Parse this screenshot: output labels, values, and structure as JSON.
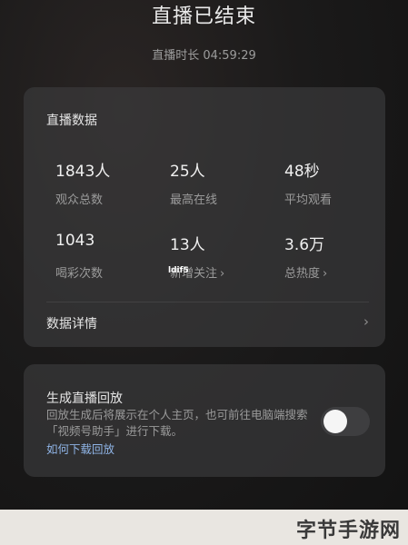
{
  "header": {
    "title": "直播已结束",
    "duration": "直播时长 04:59:29"
  },
  "stats_card": {
    "title": "直播数据",
    "stats": [
      {
        "value": "1843人",
        "label": "观众总数"
      },
      {
        "value": "25人",
        "label": "最高在线"
      },
      {
        "value": "48秒",
        "label": "平均观看"
      },
      {
        "value": "1043",
        "label": "喝彩次数"
      },
      {
        "value": "13人",
        "label": "新增关注",
        "chevron": "›"
      },
      {
        "value": "3.6万",
        "label": "总热度",
        "chevron": "›"
      }
    ],
    "overlay_text": "ldif5",
    "detail_label": "数据详情",
    "detail_chevron": "›"
  },
  "replay_card": {
    "title": "生成直播回放",
    "description": "回放生成后将展示在个人主页，也可前往电脑端搜索「视频号助手」进行下载。",
    "link": "如何下载回放",
    "toggle_on": false
  },
  "watermark": "字节手游网"
}
